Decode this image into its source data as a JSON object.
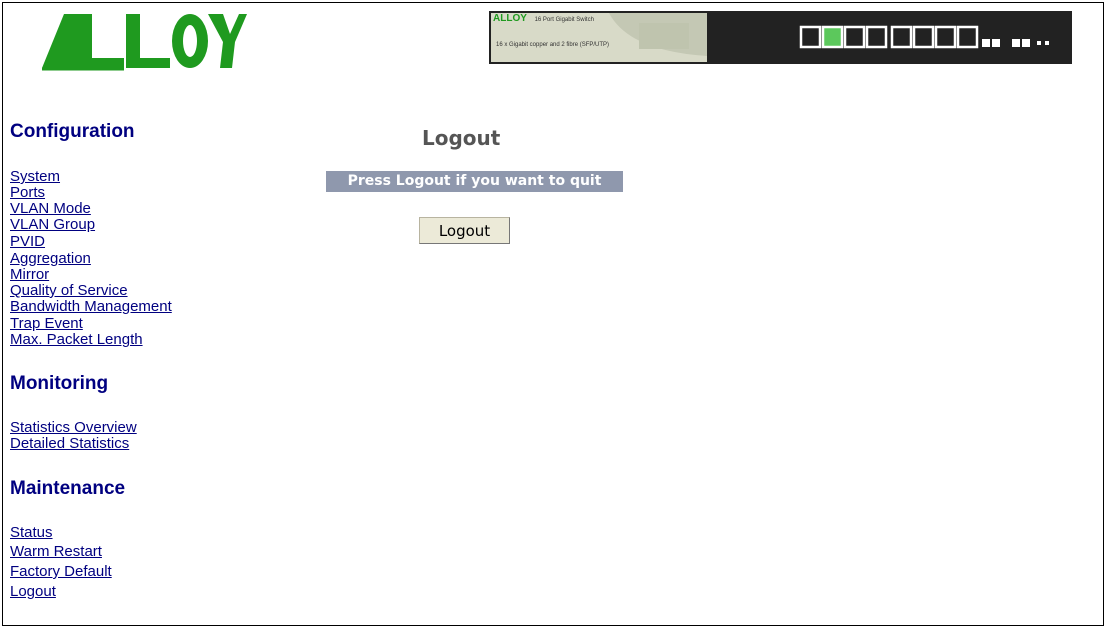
{
  "brand": {
    "logo_text": "ALLOY",
    "colors": {
      "logo_green": "#1f9a1f",
      "nav_blue": "#000080",
      "notice_bg": "#8f98ad"
    }
  },
  "device_image": {
    "icon": "switch-front-panel-icon",
    "logo_text": "ALLOY",
    "model_text": "16 Port Gigabit Switch",
    "sub_text": "16 x Gigabit copper and 2 fibre (SFP/UTP)"
  },
  "nav": {
    "configuration": {
      "heading": "Configuration",
      "items": [
        "System",
        "Ports",
        "VLAN Mode",
        "VLAN Group",
        "PVID",
        "Aggregation",
        "Mirror",
        "Quality of Service",
        "Bandwidth Management",
        "Trap Event",
        "Max. Packet Length"
      ]
    },
    "monitoring": {
      "heading": "Monitoring",
      "items": [
        "Statistics Overview",
        "Detailed Statistics"
      ]
    },
    "maintenance": {
      "heading": "Maintenance",
      "items": [
        "Status",
        "Warm Restart",
        "Factory Default",
        "Logout"
      ]
    }
  },
  "main": {
    "title": "Logout",
    "notice": "Press Logout if you want to quit",
    "button_label": "Logout"
  }
}
